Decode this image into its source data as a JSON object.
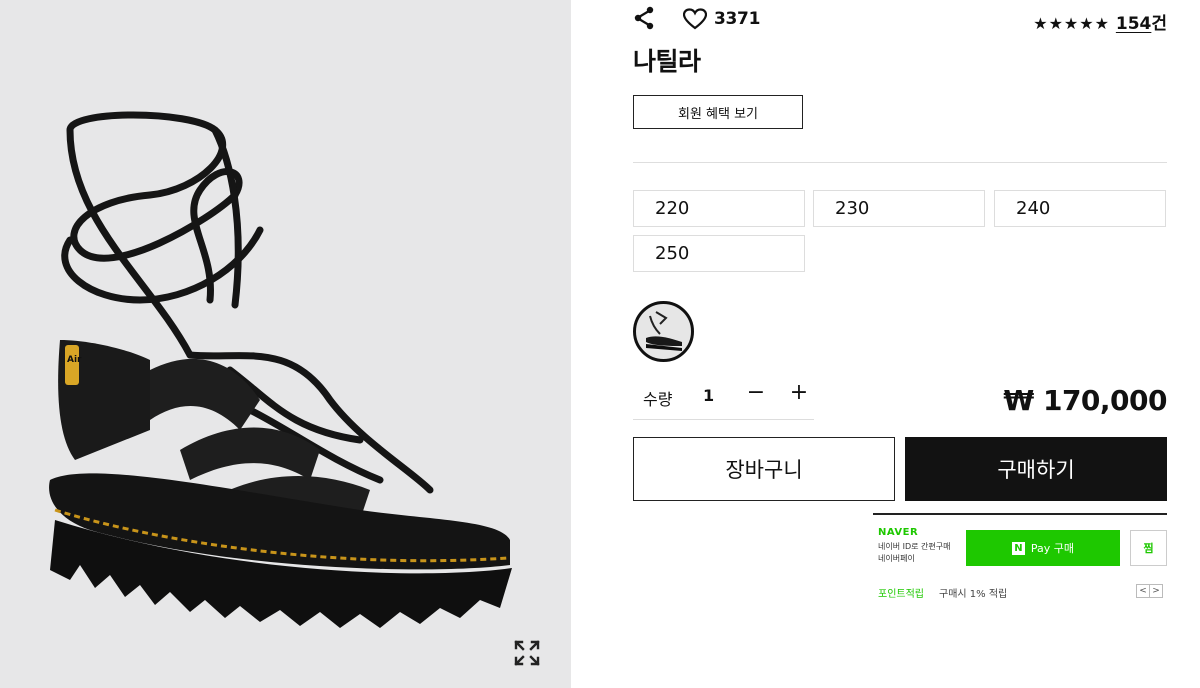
{
  "gallery": {
    "image_alt": "black strappy lace-up platform sandal",
    "zoom_icon": "expand-icon"
  },
  "header": {
    "share_icon": "share-icon",
    "like_icon": "heart-icon",
    "like_count": "3371",
    "rating_stars": "★★★★★",
    "review_count": "154",
    "review_suffix": "건"
  },
  "product": {
    "name": "나틸라",
    "benefit_button": "회원 혜택 보기",
    "sizes": [
      "220",
      "230",
      "240",
      "250"
    ],
    "quantity_label": "수량",
    "quantity": "1",
    "minus": "−",
    "plus": "+",
    "price": "₩ 170,000",
    "cart_button": "장바구니",
    "buy_button": "구매하기"
  },
  "npay": {
    "logo": "NAVER",
    "desc_line1": "네이버 ID로 간편구매",
    "desc_line2": "네이버페이",
    "n_mark": "N",
    "pay_button": "Pay 구매",
    "zzim_button": "찜",
    "point_label": "포인트적립",
    "point_desc": "구매시 1% 적립",
    "prev": "<",
    "next": ">"
  },
  "colors": {
    "gallery_bg": "#e7e7e8",
    "naver_green": "#1ec800",
    "buy_bg": "#121212"
  }
}
